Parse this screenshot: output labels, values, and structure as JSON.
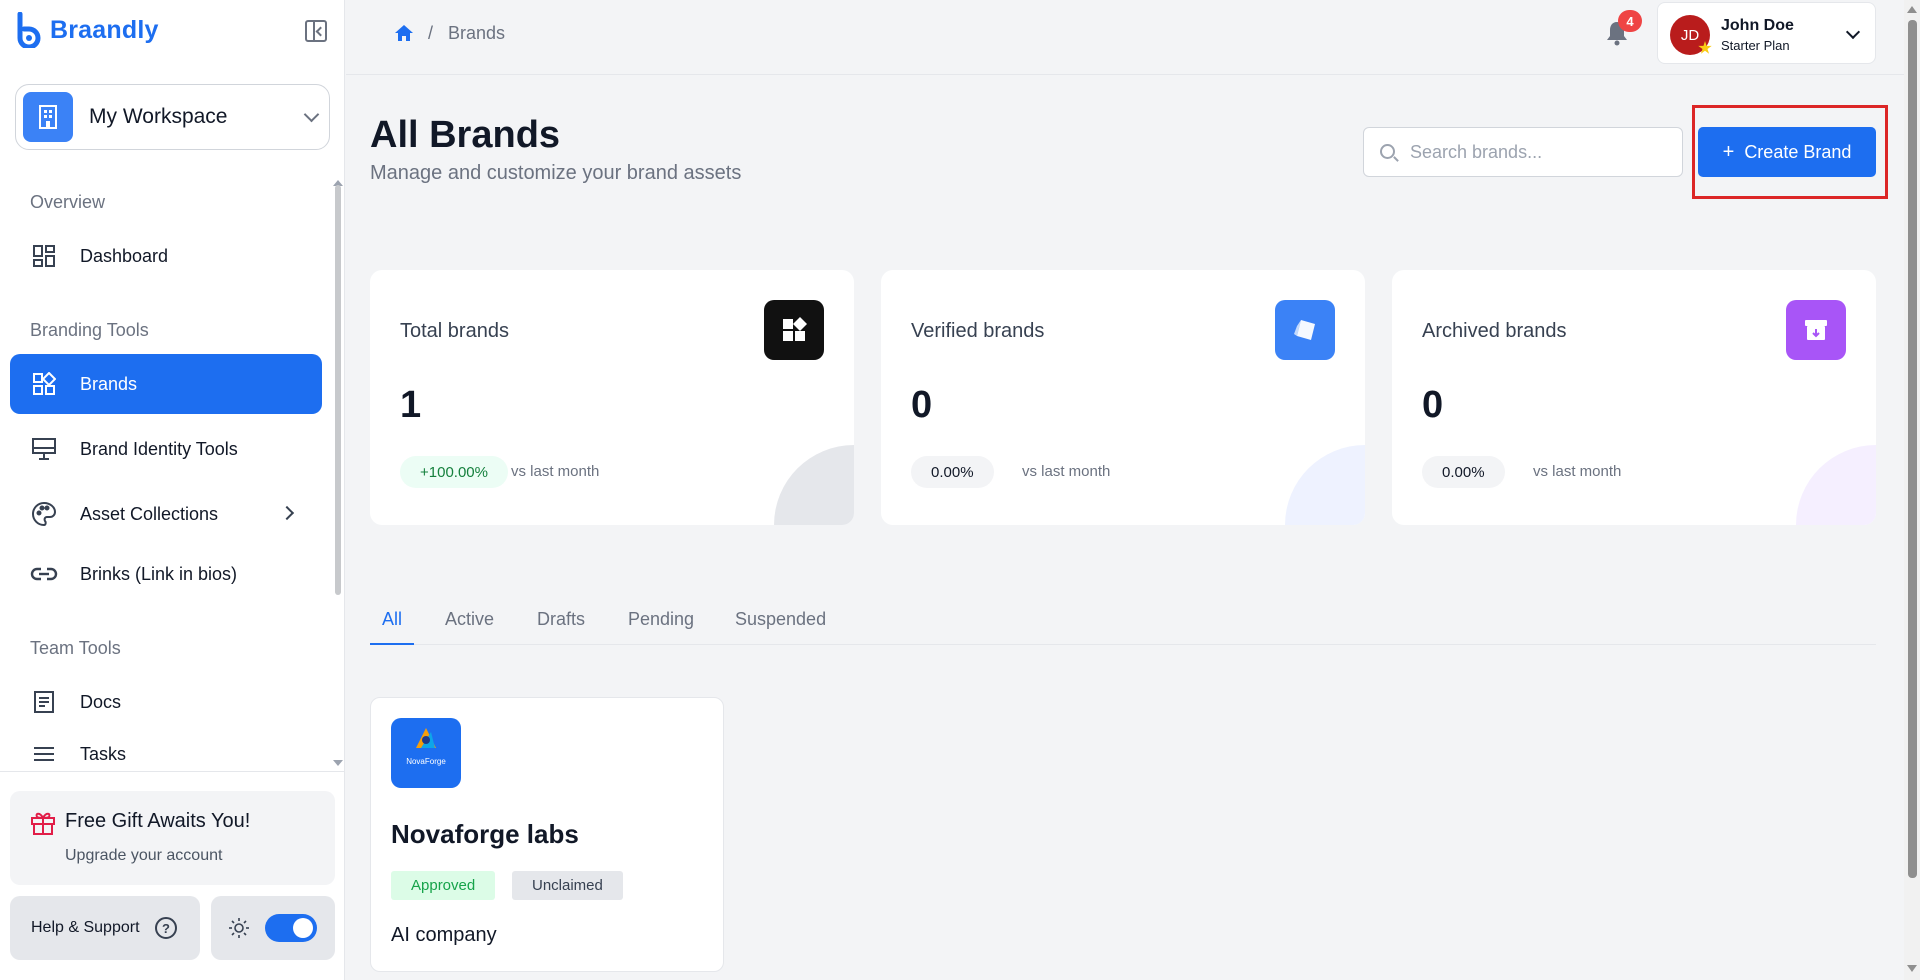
{
  "app": {
    "name": "Braandly"
  },
  "sidebar": {
    "workspace": {
      "label": "My Workspace",
      "icon": "building-icon"
    },
    "sections": {
      "overview": "Overview",
      "branding": "Branding Tools",
      "team": "Team Tools"
    },
    "items": [
      {
        "label": "Dashboard",
        "icon": "dashboard-icon"
      },
      {
        "label": "Brands",
        "icon": "brands-icon",
        "active": true
      },
      {
        "label": "Brand Identity Tools",
        "icon": "monitor-icon"
      },
      {
        "label": "Asset Collections",
        "icon": "palette-icon",
        "has_submenu": true
      },
      {
        "label": "Brinks (Link in bios)",
        "icon": "link-icon"
      },
      {
        "label": "Docs",
        "icon": "document-icon"
      },
      {
        "label": "Tasks",
        "icon": "list-icon"
      }
    ],
    "gift": {
      "title": "Free Gift Awaits You!",
      "subtitle": "Upgrade your account"
    },
    "help_label": "Help & Support",
    "theme_toggle_on": true
  },
  "topbar": {
    "breadcrumb_current": "Brands",
    "breadcrumb_sep": "/",
    "notifications_count": "4",
    "user": {
      "initials": "JD",
      "name": "John Doe",
      "plan": "Starter Plan"
    }
  },
  "header": {
    "title": "All Brands",
    "subtitle": "Manage and customize your brand assets",
    "search_placeholder": "Search brands...",
    "create_label": "Create Brand"
  },
  "stats": [
    {
      "label": "Total brands",
      "value": "1",
      "change": "+100.00%",
      "vs": "vs last month",
      "icon_bg": "#111111"
    },
    {
      "label": "Verified brands",
      "value": "0",
      "change": "0.00%",
      "vs": "vs last month",
      "icon_bg": "#3b82f6"
    },
    {
      "label": "Archived brands",
      "value": "0",
      "change": "0.00%",
      "vs": "vs last month",
      "icon_bg": "#a855f7"
    }
  ],
  "tabs": [
    "All",
    "Active",
    "Drafts",
    "Pending",
    "Suspended"
  ],
  "brands": [
    {
      "name": "Novaforge labs",
      "logo_text": "NovaForge",
      "status": "Approved",
      "claim": "Unclaimed",
      "description": "AI company"
    }
  ],
  "colors": {
    "accent": "#1d6ef0",
    "highlight": "#dc2626"
  }
}
